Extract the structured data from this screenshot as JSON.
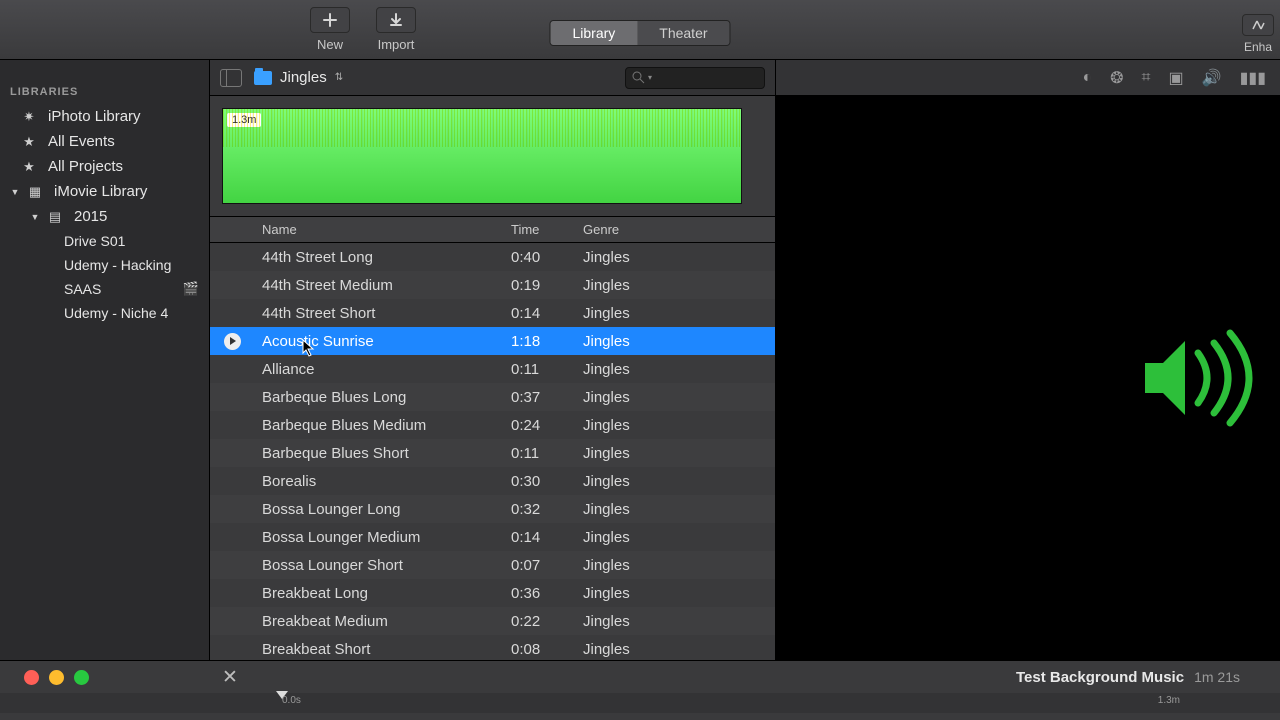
{
  "toolbar": {
    "new_label": "New",
    "import_label": "Import",
    "seg_library": "Library",
    "seg_theater": "Theater",
    "enhance_label": "Enha"
  },
  "sidebar": {
    "heading": "LIBRARIES",
    "items": [
      {
        "label": "iPhoto Library",
        "icon": "photos"
      },
      {
        "label": "All Events",
        "icon": "star"
      },
      {
        "label": "All Projects",
        "icon": "star"
      },
      {
        "label": "iMovie Library",
        "icon": "grid",
        "expanded": true
      },
      {
        "label": "2015",
        "icon": "event",
        "expanded": true
      },
      {
        "label": "Drive S01"
      },
      {
        "label": "Udemy - Hacking"
      },
      {
        "label": "SAAS",
        "trailing": "clapper"
      },
      {
        "label": "Udemy - Niche 4"
      }
    ]
  },
  "pathbar": {
    "folder_label": "Jingles"
  },
  "waveform": {
    "duration_label": "1.3m"
  },
  "columns": {
    "name": "Name",
    "time": "Time",
    "genre": "Genre"
  },
  "tracks": [
    {
      "name": "44th Street Long",
      "time": "0:40",
      "genre": "Jingles"
    },
    {
      "name": "44th Street Medium",
      "time": "0:19",
      "genre": "Jingles"
    },
    {
      "name": "44th Street Short",
      "time": "0:14",
      "genre": "Jingles"
    },
    {
      "name": "Acoustic Sunrise",
      "time": "1:18",
      "genre": "Jingles",
      "selected": true
    },
    {
      "name": "Alliance",
      "time": "0:11",
      "genre": "Jingles"
    },
    {
      "name": "Barbeque Blues Long",
      "time": "0:37",
      "genre": "Jingles"
    },
    {
      "name": "Barbeque Blues Medium",
      "time": "0:24",
      "genre": "Jingles"
    },
    {
      "name": "Barbeque Blues Short",
      "time": "0:11",
      "genre": "Jingles"
    },
    {
      "name": "Borealis",
      "time": "0:30",
      "genre": "Jingles"
    },
    {
      "name": "Bossa Lounger Long",
      "time": "0:32",
      "genre": "Jingles"
    },
    {
      "name": "Bossa Lounger Medium",
      "time": "0:14",
      "genre": "Jingles"
    },
    {
      "name": "Bossa Lounger Short",
      "time": "0:07",
      "genre": "Jingles"
    },
    {
      "name": "Breakbeat Long",
      "time": "0:36",
      "genre": "Jingles"
    },
    {
      "name": "Breakbeat Medium",
      "time": "0:22",
      "genre": "Jingles"
    },
    {
      "name": "Breakbeat Short",
      "time": "0:08",
      "genre": "Jingles"
    }
  ],
  "project": {
    "title": "Test Background Music",
    "duration": "1m 21s",
    "ruler_start": "0.0s",
    "ruler_end": "1.3m"
  },
  "colors": {
    "selection": "#1e87ff",
    "waveform": "#43d443",
    "speaker": "#2dbf3a"
  }
}
